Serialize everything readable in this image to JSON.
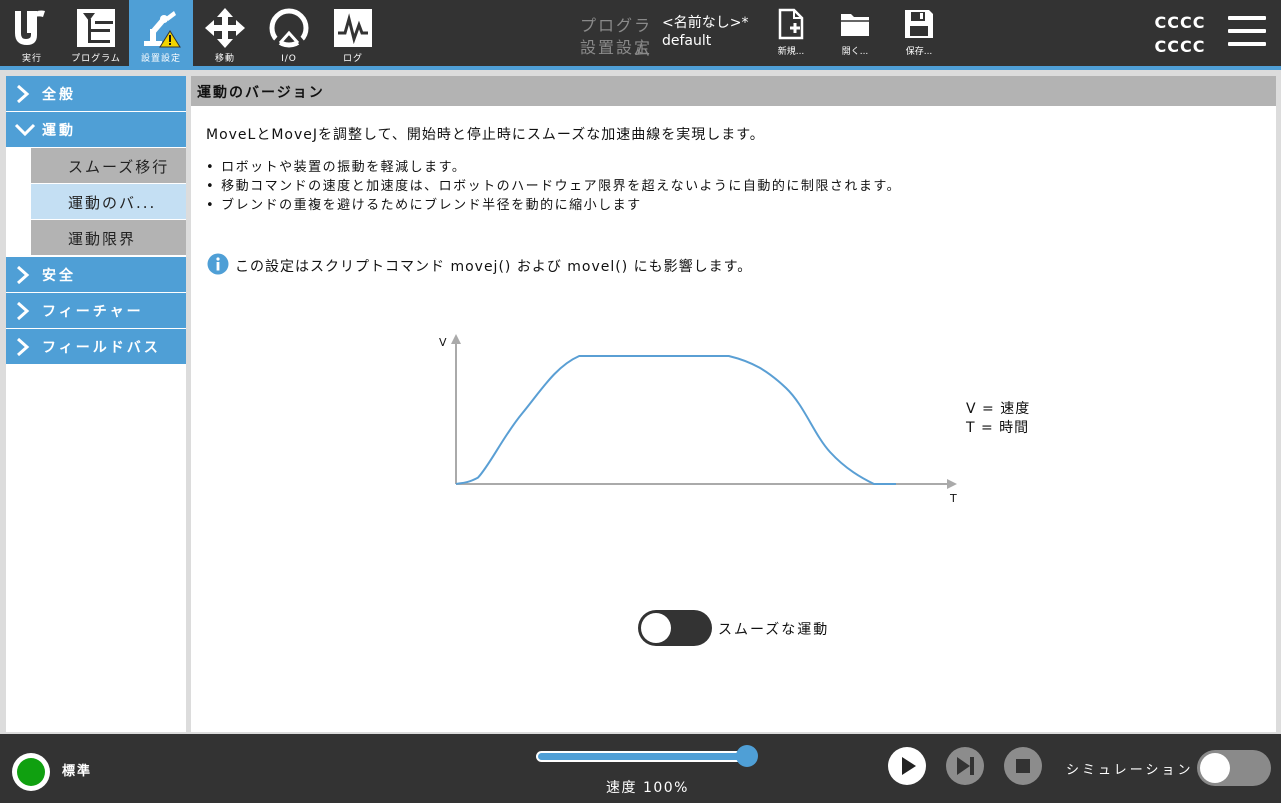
{
  "topbar": {
    "nav": [
      {
        "label": "実行",
        "icon": "ur-logo-icon"
      },
      {
        "label": "プログラム",
        "icon": "program-tree-icon"
      },
      {
        "label": "設置設定",
        "icon": "installation-robot-warning-icon",
        "active": true
      },
      {
        "label": "移動",
        "icon": "move-arrows-icon"
      },
      {
        "label": "I/O",
        "icon": "io-gauge-icon"
      },
      {
        "label": "ログ",
        "icon": "log-graph-icon"
      }
    ],
    "program_key": "プログラム",
    "program_value": "<名前なし>*",
    "installation_key": "設置設定",
    "installation_value": "default",
    "file_buttons": [
      {
        "label": "新規...",
        "icon": "new-file-icon"
      },
      {
        "label": "開く...",
        "icon": "open-folder-icon"
      },
      {
        "label": "保存...",
        "icon": "save-floppy-icon"
      }
    ],
    "user_code_line1": "CCCC",
    "user_code_line2": "CCCC"
  },
  "sidebar": {
    "items": [
      {
        "label": "全般",
        "expanded": false
      },
      {
        "label": "運動",
        "expanded": true
      }
    ],
    "sub_items": [
      {
        "label": "スムーズ移行"
      },
      {
        "label": "運動のバ...",
        "selected": true
      },
      {
        "label": "運動限界"
      }
    ],
    "items_after": [
      {
        "label": "安全"
      },
      {
        "label": "フィーチャー"
      },
      {
        "label": "フィールドバス"
      }
    ]
  },
  "main": {
    "title": "運動のバージョン",
    "description": "MoveLとMoveJを調整して、開始時と停止時にスムーズな加速曲線を実現します。",
    "bullets": [
      "ロボットや装置の振動を軽減します。",
      "移動コマンドの速度と加速度は、ロボットのハードウェア限界を超えないように自動的に制限されます。",
      "ブレンドの重複を避けるためにブレンド半径を動的に縮小します"
    ],
    "info_text": "この設定はスクリプトコマンド movej() および movel() にも影響します。",
    "toggle_label": "スムーズな運動",
    "toggle_on": false
  },
  "chart_data": {
    "type": "line",
    "xlabel": "T",
    "ylabel": "V",
    "legend": [
      "V = 速度",
      "T = 時間"
    ],
    "profile": "smooth-trapezoid",
    "x": [
      0,
      0.05,
      0.15,
      0.28,
      0.45,
      0.62,
      0.75,
      0.85,
      0.95,
      1.0
    ],
    "y": [
      0,
      0.05,
      0.55,
      1.0,
      1.0,
      1.0,
      0.75,
      0.25,
      0.0,
      0.0
    ],
    "grid": false,
    "color": "#5a9fd4"
  },
  "bottombar": {
    "status_text": "標準",
    "status_color": "#10a010",
    "speed_label": "速度 100%",
    "speed_fraction": 1.0,
    "simulation_label": "シミュレーション",
    "simulation_on": false
  },
  "colors": {
    "accent": "#4f9fd6",
    "bar": "#333333"
  }
}
